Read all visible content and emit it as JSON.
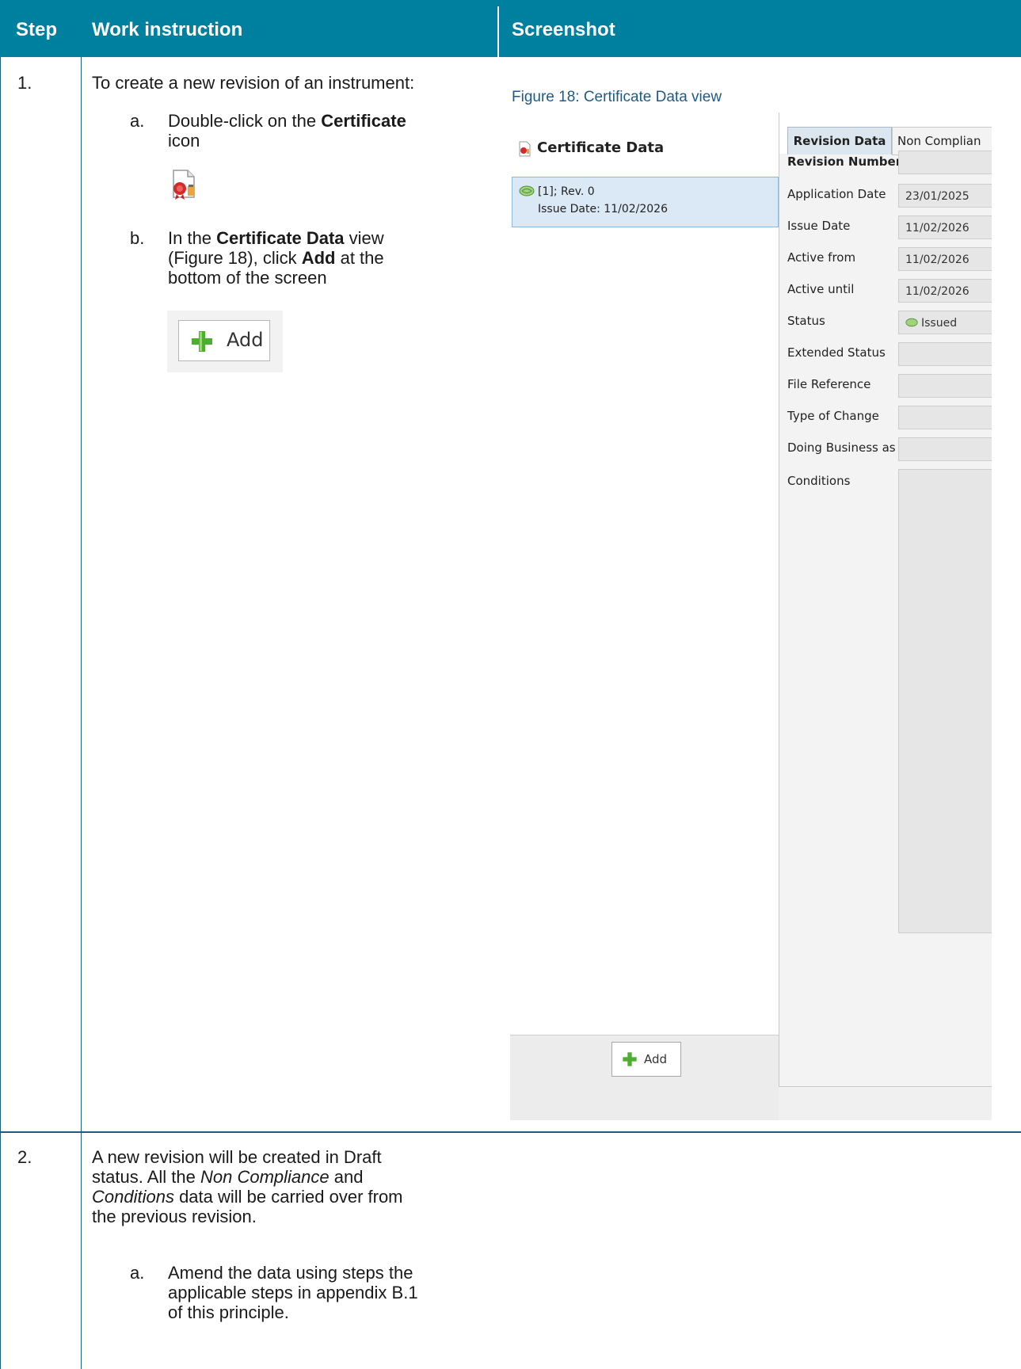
{
  "table": {
    "headers": {
      "step": "Step",
      "instruction": "Work instruction",
      "screenshot": "Screenshot"
    }
  },
  "steps": [
    {
      "number": "1.",
      "intro": "To create a new revision of an instrument:",
      "a_letter": "a.",
      "a_text_1": "Double-click on the ",
      "a_bold": "Certificate",
      "a_text_2": "icon",
      "b_letter": "b.",
      "b_text_1": "In the ",
      "b_bold_1": "Certificate Data",
      "b_text_2": " view",
      "b_line2": "(Figure 18), click ",
      "b_bold_2": "Add",
      "b_line2_end": " at the",
      "b_line3": "bottom of the screen",
      "add_label": "Add"
    },
    {
      "number": "2.",
      "line1": "A new revision will be created in Draft",
      "line2_a": "status. All the ",
      "line2_i": "Non Compliance",
      "line2_b": " and",
      "line3_i": "Conditions",
      "line3_b": " data will be carried over from",
      "line4": "the previous revision.",
      "a_letter": "a.",
      "a_line1": "Amend the data using steps the",
      "a_line2": "applicable steps in appendix B.1",
      "a_line3": "of this principle."
    }
  ],
  "figure": {
    "caption": "Figure 18: Certificate Data view",
    "left_title": "Certificate Data",
    "revision_line1": "[1]; Rev. 0",
    "revision_line2": "Issue Date: 11/02/2026",
    "add_button": "Add",
    "tabs": {
      "active": "Revision Data",
      "other": "Non Complian"
    },
    "fields": [
      {
        "label": "Revision Number",
        "value": ""
      },
      {
        "label": "Application Date",
        "value": "23/01/2025"
      },
      {
        "label": "Issue Date",
        "value": "11/02/2026"
      },
      {
        "label": "Active from",
        "value": "11/02/2026"
      },
      {
        "label": "Active until",
        "value": "11/02/2026"
      },
      {
        "label": "Status",
        "value": "Issued"
      },
      {
        "label": "Extended Status",
        "value": ""
      },
      {
        "label": "File Reference",
        "value": ""
      },
      {
        "label": "Type of Change",
        "value": ""
      },
      {
        "label": "Doing Business as",
        "value": ""
      },
      {
        "label": "Conditions",
        "value": ""
      }
    ],
    "colors": {
      "header_bg": "#00809f",
      "caption": "#1f5a87",
      "selection": "#dbe9f6"
    }
  }
}
